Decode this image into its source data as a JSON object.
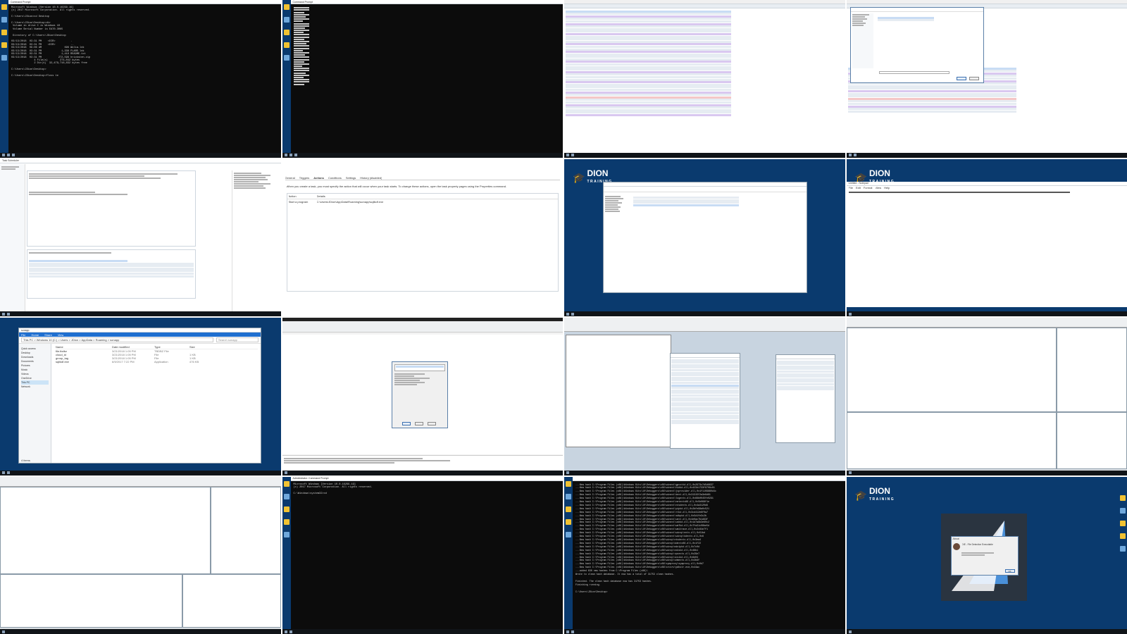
{
  "tiles": {
    "cmd1": {
      "title": "Command Prompt",
      "lines": [
        "Microsoft Windows [Version 10.0.16299.19]",
        "(c) 2017 Microsoft Corporation. All rights reserved.",
        "",
        "C:\\Users\\JDion>cd Desktop",
        "",
        "C:\\Users\\JDion\\Desktop>dir",
        " Volume in drive C is Windows 10",
        " Volume Serial Number is EA70-3065",
        "",
        " Directory of C:\\Users\\JDion\\Desktop",
        "",
        "03/13/2018  03:31 PM    <DIR>          .",
        "03/13/2018  03:31 PM    <DIR>          ..",
        "03/13/2018  09:06 AM               696 Wulia.lnk",
        "03/13/2018  03:31 PM             1,338 FLARE.lnk",
        "03/13/2018  03:31 PM             1,410 README.txt",
        "03/13/2018  03:31 PM           272,598 hricksten.zip",
        "               4 File(s)        274,042 bytes",
        "               2 Dir(s)  32,479,716,832 bytes free",
        "",
        "C:\\Users\\JDion\\Desktop>",
        "",
        "C:\\Users\\JDion\\Desktop>floss te"
      ]
    },
    "cmd2": {
      "title": "Command Prompt"
    },
    "taskmgr": {
      "title": "Task Scheduler"
    },
    "actions": {
      "tabs": [
        "General",
        "Triggers",
        "Actions",
        "Conditions",
        "Settings",
        "History (disabled)"
      ],
      "hint": "When you create a task, you must specify the action that will occur when your task starts.  To change these actions, open the task property pages using the Properties command.",
      "col_action": "Action",
      "col_details": "Details",
      "row_action": "Start a program",
      "row_details": "C:\\Users\\JDion\\AppData\\Roaming\\sonapp\\sqlikdf.exe"
    },
    "brand": {
      "name": "DION",
      "sub": "TRAINING"
    },
    "notepad": {
      "title": "Untitled - Notepad",
      "menu": [
        "File",
        "Edit",
        "Format",
        "View",
        "Help"
      ]
    },
    "explorer": {
      "title": "sonapp",
      "menu": [
        "File",
        "Home",
        "Share",
        "View"
      ],
      "path": "This PC  >  Windows 10 (C:)  >  Users  >  JDion  >  AppData  >  Roaming  >  sonapp",
      "search": "Search sonapp",
      "sidebar": [
        "Quick access",
        "Desktop",
        "Downloads",
        "Documents",
        "Pictures",
        "Music",
        "Videos",
        "OneDrive",
        "This PC",
        "Network"
      ],
      "headers": [
        "Name",
        "Date modified",
        "Type",
        "Size"
      ],
      "files": [
        {
          "name": "file.tbdbz",
          "date": "3/21/2018 1:05 PM",
          "type": "TBDBZ File",
          "size": ""
        },
        {
          "name": "cloud_id",
          "date": "3/21/2018 1:05 PM",
          "type": "File",
          "size": "1 KB"
        },
        {
          "name": "group_tag",
          "date": "3/21/2018 1:05 PM",
          "type": "File",
          "size": "1 KB"
        },
        {
          "name": "sqlikdf.exe",
          "date": "6/9/2017 7:22 PM",
          "type": "Application",
          "size": "476 KB"
        }
      ],
      "status": "4 items"
    },
    "cmd3": {
      "title": "Administrator: Command Prompt",
      "lines": [
        "Microsoft Windows [Version 10.0.16299.19]",
        "(c) 2017 Microsoft Corporation. All rights reserved.",
        "",
        "C:\\Windows\\system32>cd"
      ]
    },
    "cmd4": {
      "lines": [
        "...New hash C:\\Program Files (x86)\\Windows Kits\\10\\Debuggers\\x86\\winext\\gpcxttd.dll,0x2973c7d5d6637",
        "...New hash C:\\Program Files (x86)\\Windows Kits\\10\\Debuggers\\x86\\winext\\hidkd.dll,0x423d1733f8709c01",
        "...New hash C:\\Program Files (x86)\\Windows Kits\\10\\Debuggers\\x86\\winext\\jsprovider.dll,0x1f1109880d4c",
        "...New hash C:\\Program Files (x86)\\Windows Kits\\10\\Debuggers\\x86\\winext\\kext.dll,0x31315f2a3e6d81",
        "...New hash C:\\Program Files (x86)\\Windows Kits\\10\\Debuggers\\x86\\winext\\logexts.dll,0x66b0045fe0291",
        "...New hash C:\\Program Files (x86)\\Windows Kits\\10\\Debuggers\\x86\\winext\\netextx86.dll,0x5b068f1e",
        "...New hash C:\\Program Files (x86)\\Windows Kits\\10\\Debuggers\\x86\\winext\\ntsdexts.dll,0x4a3120d9",
        "...New hash C:\\Program Files (x86)\\Windows Kits\\10\\Debuggers\\x86\\winext\\pipkd.dll,0x2bfe98a0c521",
        "...New hash C:\\Program Files (x86)\\Windows Kits\\10\\Debuggers\\x86\\winext\\rtkd.dll,0x3cd412e6f0a7",
        "...New hash C:\\Program Files (x86)\\Windows Kits\\10\\Debuggers\\x86\\winext\\sdbpkd.dll,0x5d1fe3c2b",
        "...New hash C:\\Program Files (x86)\\Windows Kits\\10\\Debuggers\\x86\\winext\\uext.dll,0x4e0ac7b1d93f",
        "...New hash C:\\Program Files (x86)\\Windows Kits\\10\\Debuggers\\x86\\winext\\usbkd.dll,0x1d7a9b3e60c2",
        "...New hash C:\\Program Files (x86)\\Windows Kits\\10\\Debuggers\\x86\\winext\\wdfkd.dll,0x7fa31c08be5d",
        "...New hash C:\\Program Files (x86)\\Windows Kits\\10\\Debuggers\\x86\\winext\\wmitrace.dll,0x2c84e7f1",
        "...New hash C:\\Program Files (x86)\\Windows Kits\\10\\Debuggers\\x86\\winext\\winxp\\exts.dll,0x51bd",
        "...New hash C:\\Program Files (x86)\\Windows Kits\\10\\Debuggers\\x86\\winext\\winxp\\kdexts.dll,0x6",
        "...New hash C:\\Program Files (x86)\\Windows Kits\\10\\Debuggers\\x86\\winxp\\ntsdexts.dll,0x3ea4",
        "...New hash C:\\Program Files (x86)\\Windows Kits\\10\\Debuggers\\x86\\winxp\\kdextx86.dll,0x1f22",
        "...New hash C:\\Program Files (x86)\\Windows Kits\\10\\Debuggers\\x86\\winxp\\minipkd.dll,0x7c0d",
        "...New hash C:\\Program Files (x86)\\Windows Kits\\10\\Debuggers\\x86\\winxp\\ndiskd.dll,0x48b1",
        "...New hash C:\\Program Files (x86)\\Windows Kits\\10\\Debuggers\\x86\\winxp\\rpcexts.dll,0x29e7",
        "...New hash C:\\Program Files (x86)\\Windows Kits\\10\\Debuggers\\x86\\winxp\\scsikd.dll,0x6d04",
        "...New hash C:\\Program Files (x86)\\Windows Kits\\10\\Debuggers\\x86\\winxp\\vdmexts.dll,0x3b9f",
        "...New hash C:\\Program Files (x86)\\Windows Kits\\10\\Debuggers\\x86\\symproxy\\symproxy.dll,0x0d7",
        "...New hash C:\\Program Files (x86)\\Windows Kits\\10\\Debuggers\\x86\\srcsrv\\pdbstr.exe,0x44ac",
        "...added 630 new hashes from C:\\Program Files (x86)\\",
        "Wrote to clean hash database. It now has a total of 31753 clean hashes.",
        "",
        "Finished. The clean hash database now has 31753 hashes.",
        "Finishing running.",
        "",
        "C:\\Users\\JDion\\Desktop>"
      ]
    },
    "about": {
      "title": "About",
      "product": "DIE - File Detection Executable",
      "button": "OK"
    }
  },
  "taskbar_time": "",
  "colors": {
    "desktop": "#0a3a6e",
    "console": "#0c0c0c",
    "highlight": "#1f6fd0"
  }
}
